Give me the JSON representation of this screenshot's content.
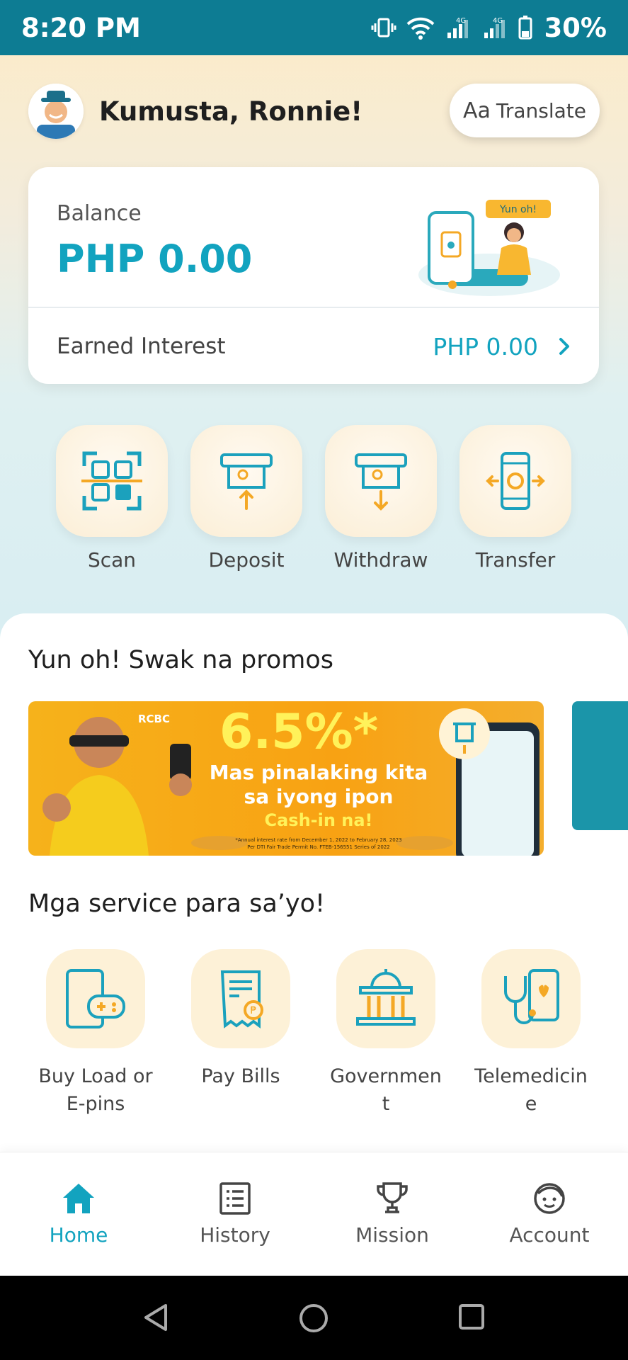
{
  "status": {
    "time": "8:20 PM",
    "battery": "30%",
    "network": "4G"
  },
  "header": {
    "greeting": "Kumusta, Ronnie!",
    "translate_icon": "Aa",
    "translate_label": "Translate"
  },
  "balance": {
    "label": "Balance",
    "value": "PHP 0.00",
    "interest_label": "Earned Interest",
    "interest_value": "PHP 0.00",
    "illustration_caption": "Yun oh!"
  },
  "actions": [
    {
      "label": "Scan",
      "icon": "qr-scan-icon"
    },
    {
      "label": "Deposit",
      "icon": "deposit-icon"
    },
    {
      "label": "Withdraw",
      "icon": "withdraw-icon"
    },
    {
      "label": "Transfer",
      "icon": "transfer-icon"
    }
  ],
  "promos": {
    "title": "Yun oh! Swak na promos",
    "banner": {
      "rate": "6.5%*",
      "line1": "Mas pinalaking kita",
      "line2": "sa iyong ipon",
      "cta": "Cash-in na!",
      "brand": "RCBC",
      "footnote1": "*Annual interest rate from December 1, 2022 to February 28, 2023",
      "footnote2": "Per DTI Fair Trade Permit No. FTEB-156551 Series of 2022"
    }
  },
  "services": {
    "title": "Mga service para sa’yo!",
    "items": [
      {
        "label": "Buy Load or E-pins",
        "icon": "gamepad-phone-icon"
      },
      {
        "label": "Pay Bills",
        "icon": "bill-icon"
      },
      {
        "label": "Government",
        "icon": "government-building-icon"
      },
      {
        "label": "Telemedicine",
        "icon": "stethoscope-icon"
      }
    ]
  },
  "nav": [
    {
      "label": "Home",
      "icon": "home-icon",
      "active": true
    },
    {
      "label": "History",
      "icon": "history-icon",
      "active": false
    },
    {
      "label": "Mission",
      "icon": "trophy-icon",
      "active": false
    },
    {
      "label": "Account",
      "icon": "account-icon",
      "active": false
    }
  ],
  "colors": {
    "accent": "#12a3bf",
    "statusbar": "#0d7c93",
    "tile": "#fdf1d7",
    "promo": "#f6b21b"
  }
}
